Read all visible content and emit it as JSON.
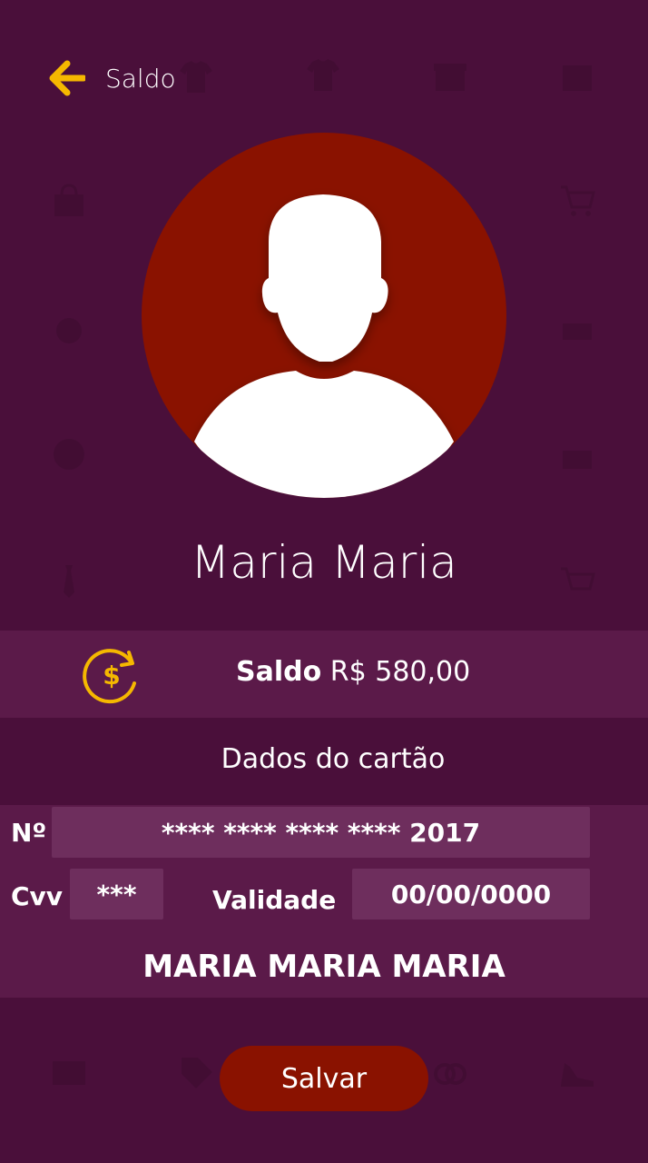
{
  "header": {
    "title": "Saldo",
    "back_icon": "arrow-left-icon"
  },
  "profile": {
    "name": "Maria Maria",
    "avatar_icon": "user-silhouette-icon"
  },
  "balance": {
    "label": "Saldo",
    "value": "R$ 580,00",
    "icon": "dollar-refresh-icon"
  },
  "card": {
    "section_title": "Dados do cartão",
    "number_label": "Nº",
    "number_value": "**** **** **** **** 2017",
    "cvv_label": "Cvv",
    "cvv_value": "***",
    "validity_label": "Validade",
    "validity_value": "00/00/0000",
    "holder_name": "MARIA MARIA MARIA"
  },
  "actions": {
    "save_label": "Salvar"
  },
  "colors": {
    "background": "#4a0f3a",
    "panel": "#5b1a49",
    "field": "#6e2e5d",
    "accent_red": "#8a1200",
    "icon_yellow": "#f5b800"
  }
}
